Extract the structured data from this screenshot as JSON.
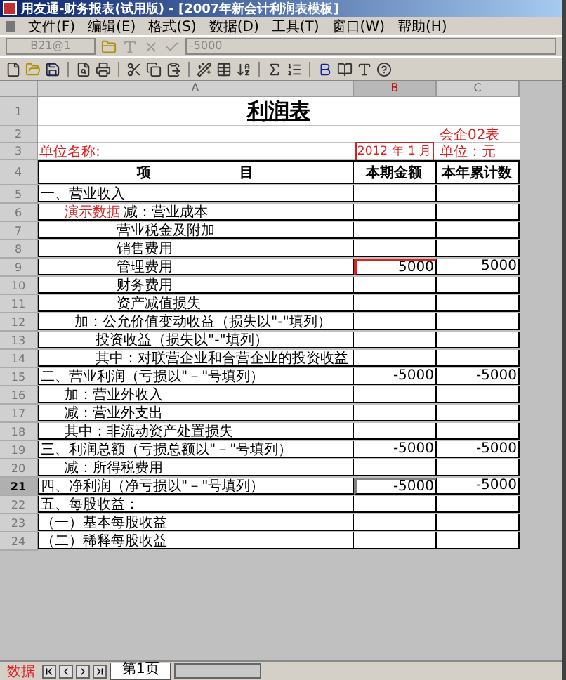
{
  "window": {
    "title": "用友通-财务报表(试用版) - [2007年新会计利润表模板]"
  },
  "menu": [
    "文件(F)",
    "编辑(E)",
    "格式(S)",
    "数据(D)",
    "工具(T)",
    "窗口(W)",
    "帮助(H)"
  ],
  "formula_bar": {
    "cell": "B21@1",
    "value": "-5000"
  },
  "columns": [
    "A",
    "B",
    "C"
  ],
  "rows": [
    {
      "num": "1",
      "kind": "title",
      "a": "利润表",
      "selected": false
    },
    {
      "num": "2",
      "kind": "meta",
      "c": "会企02表",
      "selected": false
    },
    {
      "num": "3",
      "kind": "meta",
      "a": "单位名称:",
      "b": "2012 年 1 月",
      "c": "单位：元",
      "selected": false
    },
    {
      "num": "4",
      "kind": "header",
      "a": "项 目",
      "b": "本期金额",
      "c": "本年累计数",
      "selected": false
    },
    {
      "num": "5",
      "kind": "indent0",
      "a": "一、营业收入",
      "selected": false
    },
    {
      "num": "6",
      "kind": "indent1",
      "note": "演示数据",
      "a": "减：营业成本",
      "selected": false
    },
    {
      "num": "7",
      "kind": "indent4",
      "a": "营业税金及附加",
      "selected": false
    },
    {
      "num": "8",
      "kind": "indent4",
      "a": "销售费用",
      "selected": false
    },
    {
      "num": "9",
      "kind": "indent4",
      "a": "管理费用",
      "b": "5000",
      "c": "5000",
      "flagged": true,
      "selected": false
    },
    {
      "num": "10",
      "kind": "indent4",
      "a": "财务费用",
      "selected": false
    },
    {
      "num": "11",
      "kind": "indent4",
      "a": "资产减值损失",
      "selected": false
    },
    {
      "num": "12",
      "kind": "indent2",
      "a": "加：公允价值变动收益（损失以\"-\"填列）",
      "selected": false
    },
    {
      "num": "13",
      "kind": "indent3",
      "a": "投资收益（损失以\"-\"填列）",
      "selected": false
    },
    {
      "num": "14",
      "kind": "indent3",
      "a": "其中：对联营企业和合营企业的投资收益",
      "selected": false
    },
    {
      "num": "15",
      "kind": "indent0",
      "a": "二、营业利润（亏损以\"－\"号填列）",
      "b": "-5000",
      "c": "-5000",
      "selected": false
    },
    {
      "num": "16",
      "kind": "indent1",
      "a": "加：营业外收入",
      "selected": false
    },
    {
      "num": "17",
      "kind": "indent1",
      "a": "减：营业外支出",
      "selected": false
    },
    {
      "num": "18",
      "kind": "indent1",
      "a": "其中：非流动资产处置损失",
      "selected": false
    },
    {
      "num": "19",
      "kind": "indent0",
      "a": "三、利润总额（亏损总额以\"－\"号填列）",
      "b": "-5000",
      "c": "-5000",
      "selected": false
    },
    {
      "num": "20",
      "kind": "indent1",
      "a": "减：所得税费用",
      "selected": false
    },
    {
      "num": "21",
      "kind": "indent0",
      "a": "四、净利润（净亏损以\"－\"号填列）",
      "b": "-5000",
      "c": "-5000",
      "selected": true
    },
    {
      "num": "22",
      "kind": "indent0",
      "a": "五、每股收益：",
      "selected": false
    },
    {
      "num": "23",
      "kind": "indent0",
      "a": "（一）基本每股收益",
      "selected": false
    },
    {
      "num": "24",
      "kind": "indent0",
      "a": "（二）稀释每股收益",
      "selected": false
    }
  ],
  "status": "数据",
  "sheet_tabs": [
    {
      "label": "第1页",
      "selected": true
    }
  ]
}
